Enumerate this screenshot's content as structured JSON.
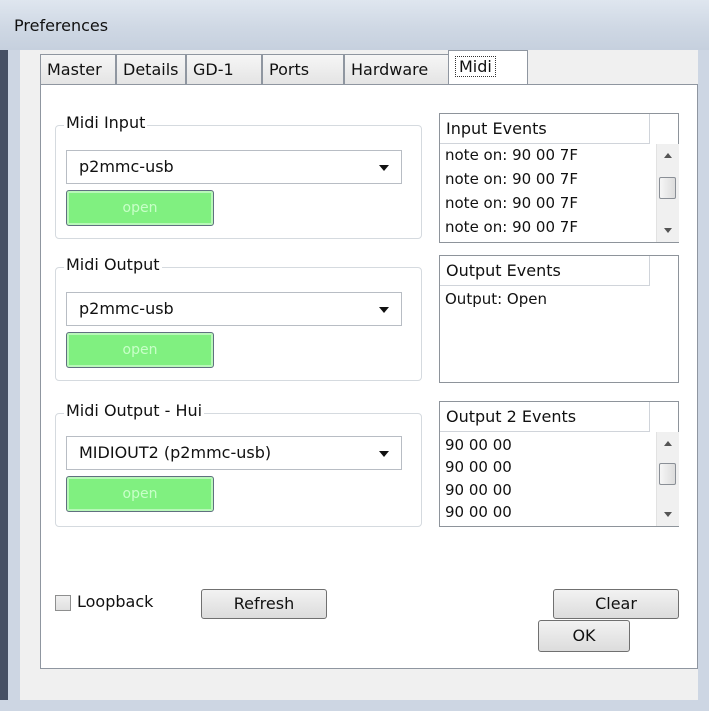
{
  "window": {
    "title": "Preferences"
  },
  "tabs": [
    "Master",
    "Details",
    "GD-1",
    "Ports",
    "Hardware",
    "Midi"
  ],
  "midi_input": {
    "title": "Midi Input",
    "selected": "p2mmc-usb",
    "button": "open"
  },
  "midi_output": {
    "title": "Midi Output",
    "selected": "p2mmc-usb",
    "button": "open"
  },
  "midi_output_hui": {
    "title": "Midi Output - Hui",
    "selected": "MIDIOUT2 (p2mmc-usb)",
    "button": "open"
  },
  "input_events": {
    "header": "Input Events",
    "rows": [
      "note on: 90 00 7F",
      "note on: 90 00 7F",
      "note on: 90 00 7F",
      "note on: 90 00 7F"
    ]
  },
  "output_events": {
    "header": "Output Events",
    "rows": [
      "Output: Open"
    ]
  },
  "output2_events": {
    "header": "Output 2 Events",
    "rows": [
      "90 00 00",
      "90 00 00",
      "90 00 00",
      "90 00 00"
    ]
  },
  "controls": {
    "loopback": "Loopback",
    "refresh": "Refresh",
    "clear": "Clear",
    "ok": "OK"
  },
  "colors": {
    "open_button": "#80f080"
  },
  "icons": [
    "dropdown-arrow-icon",
    "scroll-up-icon",
    "scroll-down-icon"
  ]
}
